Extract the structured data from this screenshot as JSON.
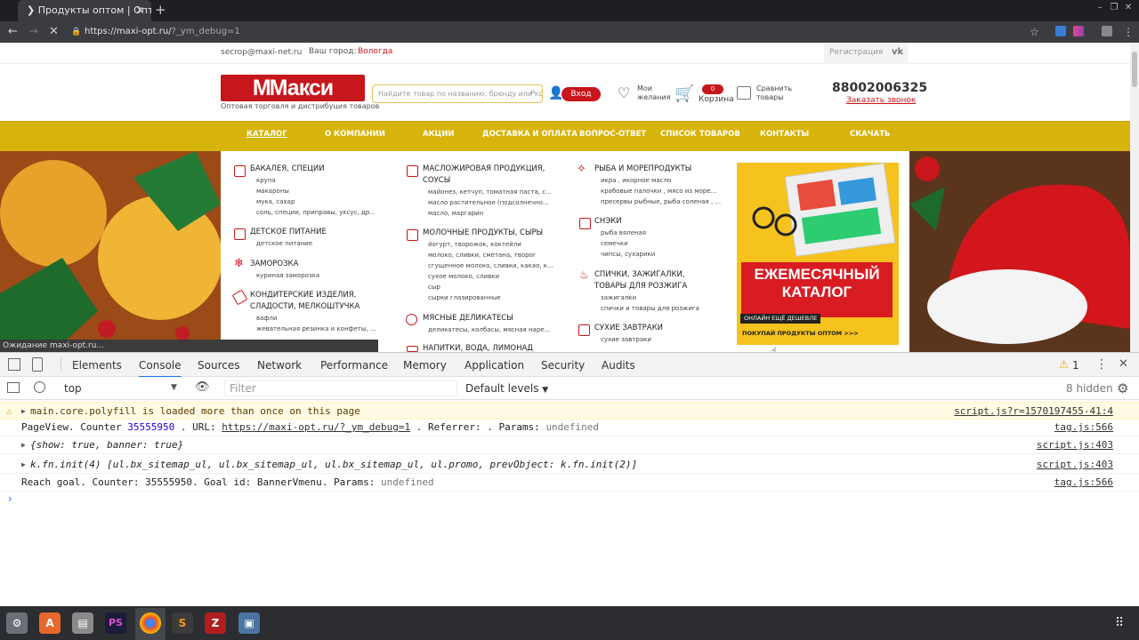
{
  "browser": {
    "tab_title": "Продукты оптом | Опто",
    "url_main": "https://maxi-opt.ru/",
    "url_query": "?_ym_debug=1"
  },
  "site": {
    "email": "secrop@maxi-net.ru",
    "city_label": "Ваш город:",
    "city": "Вологда",
    "register": "Регистрация",
    "vk": "vk",
    "logo": "Макси",
    "tagline": "Оптовая торговля и дистрибуция товаров",
    "search_placeholder": "Найдите товар по названию, бренду или коду",
    "login": "Вход",
    "wishlist": "Мои желания",
    "cart_count": "0",
    "cart_label": "Корзина",
    "compare": "Сравнить товары",
    "phone": "88002006325",
    "callback": "Заказать звонок",
    "nav": [
      "КАТАЛОГ",
      "О КОМПАНИИ",
      "АКЦИИ",
      "ДОСТАВКА И ОПЛАТА",
      "ВОПРОС-ОТВЕТ",
      "СПИСОК ТОВАРОВ",
      "КОНТАКТЫ",
      "СКАЧАТЬ"
    ],
    "menu": {
      "c1": [
        {
          "title": "БАКАЛЕЯ, СПЕЦИИ",
          "subs": [
            "крупа",
            "макароны",
            "мука, сахар",
            "соль, специи, приправы, уксус, др..."
          ]
        },
        {
          "title": "ДЕТСКОЕ ПИТАНИЕ",
          "subs": [
            "детское питание"
          ]
        },
        {
          "title": "ЗАМОРОЗКА",
          "subs": [
            "куриная заморозка"
          ]
        },
        {
          "title": "КОНДИТЕРСКИЕ ИЗДЕЛИЯ, СЛАДОСТИ, МЕЛКОШТУЧКА",
          "subs": [
            "вафли",
            "жевательная резинка и конфеты, ..."
          ]
        }
      ],
      "c2": [
        {
          "title": "МАСЛОЖИРОВАЯ ПРОДУКЦИЯ, СОУСЫ",
          "subs": [
            "майонез, кетчуп, томатная паста, с...",
            "масло растительное (подсолнечно...",
            "масло, маргарин"
          ]
        },
        {
          "title": "МОЛОЧНЫЕ ПРОДУКТЫ, СЫРЫ",
          "subs": [
            "йогурт, творожок, коктейли",
            "молоко, сливки, сметана, творог",
            "сгущенное молоко, сливки, какао, к...",
            "сухое молоко, сливки",
            "сыр",
            "сырки глазированные"
          ]
        },
        {
          "title": "МЯСНЫЕ ДЕЛИКАТЕСЫ",
          "subs": [
            "деликатесы, колбасы, мясная наре..."
          ]
        },
        {
          "title": "НАПИТКИ, ВОДА, ЛИМОНАД",
          "subs": []
        }
      ],
      "c3": [
        {
          "title": "РЫБА И МОРЕПРОДУКТЫ",
          "subs": [
            "икра , икорное масло",
            "крабовые палочки , мясо из море...",
            "пресервы рыбные, рыба соленая , ..."
          ]
        },
        {
          "title": "СНЭКИ",
          "subs": [
            "рыба вяленая",
            "семечки",
            "чипсы, сухарики"
          ]
        },
        {
          "title": "СПИЧКИ, ЗАЖИГАЛКИ, ТОВАРЫ ДЛЯ РОЗЖИГА",
          "subs": [
            "зажигалки",
            "спички и товары для розжига"
          ]
        },
        {
          "title": "СУХИЕ ЗАВТРАКИ",
          "subs": [
            "сухие завтраки"
          ]
        }
      ]
    },
    "promo_title": "ЕЖЕМЕСЯЧНЫЙ КАТАЛОГ",
    "promo_sub": "ОНЛАЙН ЕЩЁ ДЕШЕВЛЕ",
    "promo_link": "ПОКУПАЙ ПРОДУКТЫ ОПТОМ >>>",
    "status_tip": "Ожидание maxi-opt.ru..."
  },
  "devtools": {
    "tabs": [
      "Elements",
      "Console",
      "Sources",
      "Network",
      "Performance",
      "Memory",
      "Application",
      "Security",
      "Audits"
    ],
    "active_tab": "Console",
    "warn_count": "1",
    "context": "top",
    "filter_placeholder": "Filter",
    "levels": "Default levels",
    "hidden": "8 hidden",
    "rows": [
      {
        "type": "warn",
        "text": "main.core.polyfill is loaded more than once on this page",
        "src": "script.js?r=1570197455-41:4"
      },
      {
        "type": "log",
        "p1": "PageView. Counter ",
        "num": "35555950",
        "p2": " . URL: ",
        "link": "https://maxi-opt.ru/?_ym_debug=1",
        "p3": " . Referrer:  . Params: ",
        "undef": "undefined",
        "src": "tag.js:566"
      },
      {
        "type": "obj",
        "text": "{show: true, banner: true}",
        "src": "script.js:403"
      },
      {
        "type": "obj",
        "text": "k.fn.init(4) [ul.bx_sitemap_ul, ul.bx_sitemap_ul, ul.bx_sitemap_ul, ul.promo, prevObject: k.fn.init(2)]",
        "src": "script.js:403"
      },
      {
        "type": "log",
        "text": "Reach goal. Counter: 35555950. Goal id: BannerVmenu. Params: ",
        "undef": "undefined",
        "src": "tag.js:566"
      }
    ]
  },
  "colors": {
    "brand": "#c8161d",
    "nav": "#d7b40b",
    "devtools_accent": "#1a73e8"
  }
}
